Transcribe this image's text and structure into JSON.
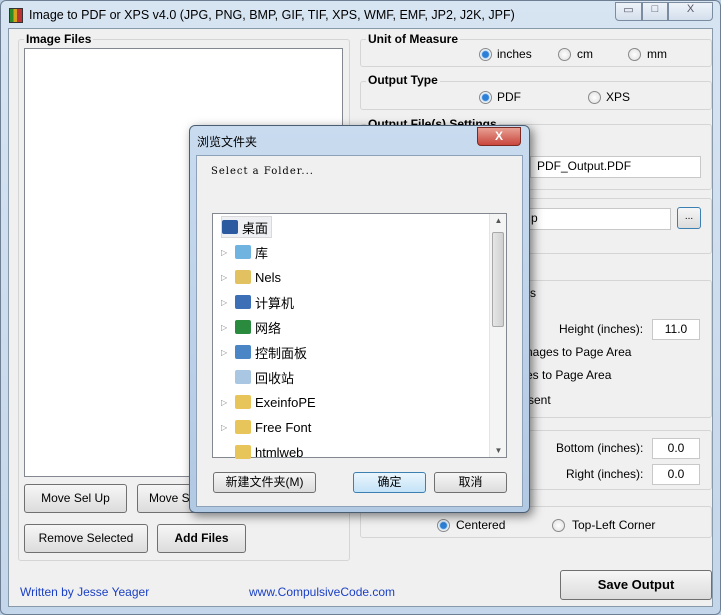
{
  "window": {
    "title": "Image to PDF or XPS  v4.0   (JPG, PNG, BMP, GIF, TIF, XPS, WMF, EMF, JP2, J2K, JPF)",
    "minimize": "▭",
    "maximize": "□",
    "close": "X"
  },
  "image_files": {
    "label": "Image Files",
    "move_up": "Move Sel Up",
    "move_down_visible": "Move S",
    "remove": "Remove Selected",
    "add": "Add Files"
  },
  "unit": {
    "label": "Unit of Measure",
    "options": [
      "inches",
      "cm",
      "mm"
    ],
    "selected": "inches"
  },
  "output_type": {
    "label": "Output Type",
    "options": [
      "PDF",
      "XPS"
    ],
    "selected": "PDF"
  },
  "output_settings": {
    "label": "Output File(s) Settings",
    "filename": "PDF_Output.PDF",
    "folder_visible": "p",
    "browse": "..."
  },
  "page": {
    "label_visible": "s",
    "height_label": "Height (inches):",
    "height": "11.0",
    "opt1_visible": "nages to Page Area",
    "opt2_visible": "es to Page Area",
    "opt3_visible": "sent"
  },
  "margins": {
    "bottom_label": "Bottom (inches):",
    "bottom": "0.0",
    "right_label": "Right (inches):",
    "right": "0.0"
  },
  "position": {
    "options": [
      "Centered",
      "Top-Left Corner"
    ],
    "selected": "Centered"
  },
  "save": "Save Output",
  "footer": {
    "author": "Written by Jesse Yeager",
    "site": "www.CompulsiveCode.com"
  },
  "dialog": {
    "title": "浏览文件夹",
    "close": "X",
    "prompt": "Select a Folder...",
    "tree": [
      {
        "label": "桌面",
        "icon": "desktop-icon",
        "expander": false,
        "selected": true
      },
      {
        "label": "库",
        "icon": "library-icon",
        "expander": true
      },
      {
        "label": "Nels",
        "icon": "user-folder-icon",
        "expander": true
      },
      {
        "label": "计算机",
        "icon": "computer-icon",
        "expander": true
      },
      {
        "label": "网络",
        "icon": "network-icon",
        "expander": true
      },
      {
        "label": "控制面板",
        "icon": "control-panel-icon",
        "expander": true
      },
      {
        "label": "回收站",
        "icon": "recycle-bin-icon",
        "expander": false
      },
      {
        "label": "ExeinfoPE",
        "icon": "folder-icon",
        "expander": true
      },
      {
        "label": "Free Font",
        "icon": "folder-icon",
        "expander": true
      },
      {
        "label": "htmlweb",
        "icon": "folder-icon",
        "expander": false
      }
    ],
    "new_folder": "新建文件夹(M)",
    "ok": "确定",
    "cancel": "取消"
  },
  "colors": {
    "accent": "#2b7fd6",
    "link": "#1a3fc4",
    "close_red": "#c9463d"
  }
}
